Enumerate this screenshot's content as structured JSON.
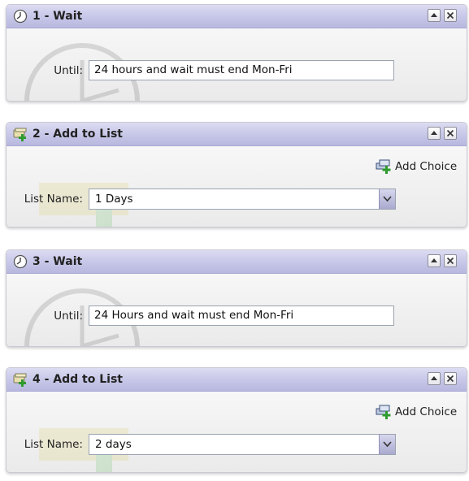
{
  "steps": [
    {
      "title": "1 - Wait",
      "type": "wait",
      "icon": "clock-icon",
      "field_label": "Until:",
      "value": "24 hours and wait must end Mon-Fri"
    },
    {
      "title": "2 - Add to List",
      "type": "list",
      "icon": "list-add-icon",
      "add_choice_label": "Add Choice",
      "field_label": "List Name:",
      "value": "1 Days"
    },
    {
      "title": "3 - Wait",
      "type": "wait",
      "icon": "clock-icon",
      "field_label": "Until:",
      "value": "24 Hours and wait must end Mon-Fri"
    },
    {
      "title": "4 - Add to List",
      "type": "list",
      "icon": "list-add-icon",
      "add_choice_label": "Add Choice",
      "field_label": "List Name:",
      "value": "2 days"
    }
  ],
  "colors": {
    "header": "#c6c6e8",
    "header_border": "#a9a9d4",
    "body": "#f2f2f2"
  }
}
